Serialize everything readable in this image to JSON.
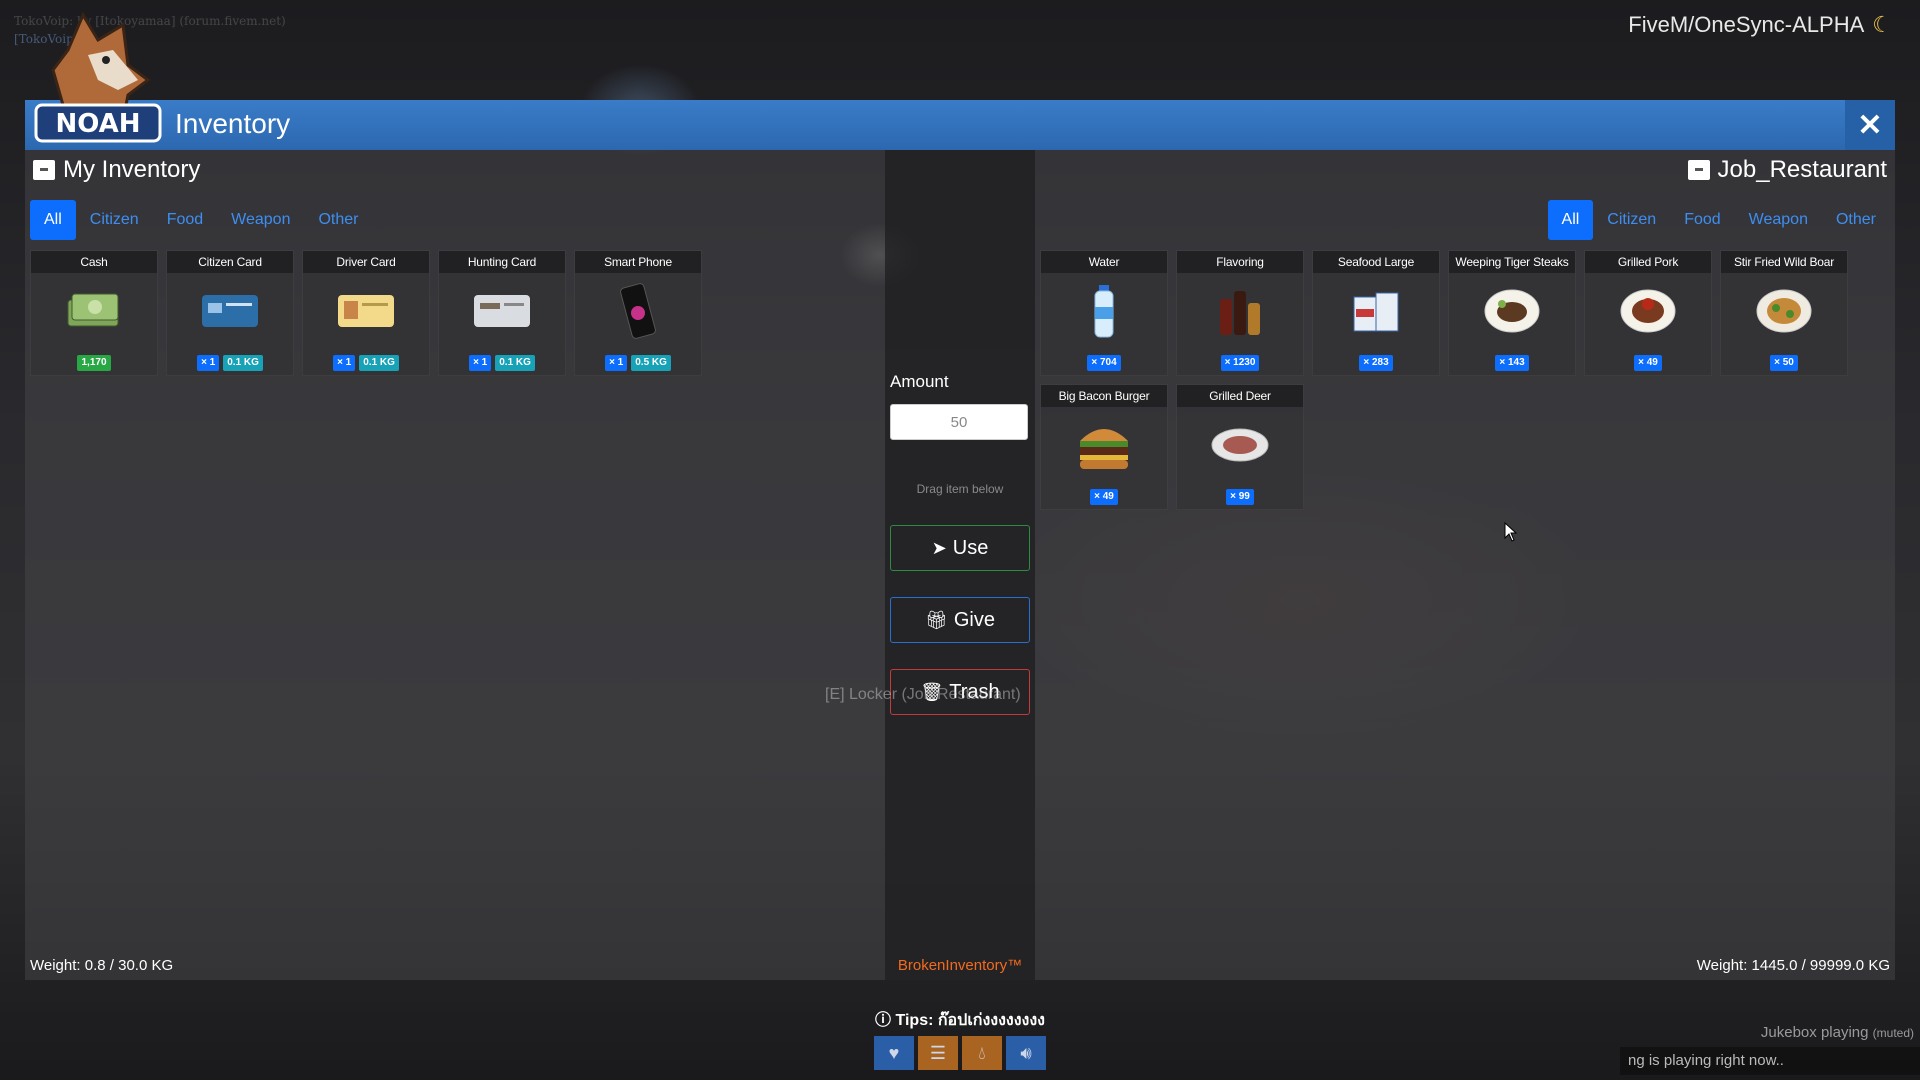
{
  "server_name": "FiveM/OneSync-ALPHA",
  "credit_line1": "TokoVoip: by [Itokoyamaa] (forum.fivem.net)",
  "credit_line2": "[TokoVoip]",
  "logo_text": "NOAH",
  "window": {
    "title": "Inventory",
    "close_label": "✕"
  },
  "left_panel": {
    "title": "My Inventory",
    "tabs": [
      "All",
      "Citizen",
      "Food",
      "Weapon",
      "Other"
    ],
    "items": [
      {
        "name": "Cash",
        "badges": [
          {
            "text": "1,170",
            "color": "green"
          }
        ],
        "icon": "cash-icon"
      },
      {
        "name": "Citizen Card",
        "badges": [
          {
            "text": "× 1",
            "color": "blue"
          },
          {
            "text": "0.1 KG",
            "color": "teal"
          }
        ],
        "icon": "citizen-card-icon"
      },
      {
        "name": "Driver Card",
        "badges": [
          {
            "text": "× 1",
            "color": "blue"
          },
          {
            "text": "0.1 KG",
            "color": "teal"
          }
        ],
        "icon": "driver-card-icon"
      },
      {
        "name": "Hunting Card",
        "badges": [
          {
            "text": "× 1",
            "color": "blue"
          },
          {
            "text": "0.1 KG",
            "color": "teal"
          }
        ],
        "icon": "hunting-card-icon"
      },
      {
        "name": "Smart Phone",
        "badges": [
          {
            "text": "× 1",
            "color": "blue"
          },
          {
            "text": "0.5 KG",
            "color": "teal"
          }
        ],
        "icon": "smart-phone-icon"
      }
    ],
    "weight": "Weight: 0.8 / 30.0 KG"
  },
  "center": {
    "amount_label": "Amount",
    "amount_value": "50",
    "drag_hint": "Drag item below",
    "use_label": "Use",
    "give_label": "Give",
    "trash_label": "Trash",
    "brand": "BrokenInventory™"
  },
  "right_panel": {
    "title": "Job_Restaurant",
    "tabs": [
      "All",
      "Citizen",
      "Food",
      "Weapon",
      "Other"
    ],
    "items": [
      {
        "name": "Water",
        "badges": [
          {
            "text": "× 704",
            "color": "blue"
          }
        ],
        "icon": "water-bottle-icon"
      },
      {
        "name": "Flavoring",
        "badges": [
          {
            "text": "× 1230",
            "color": "blue"
          }
        ],
        "icon": "flavoring-icon"
      },
      {
        "name": "Seafood Large",
        "badges": [
          {
            "text": "× 283",
            "color": "blue"
          }
        ],
        "icon": "seafood-icon"
      },
      {
        "name": "Weeping Tiger Steaks",
        "badges": [
          {
            "text": "× 143",
            "color": "blue"
          }
        ],
        "icon": "steak-icon"
      },
      {
        "name": "Grilled Pork",
        "badges": [
          {
            "text": "× 49",
            "color": "blue"
          }
        ],
        "icon": "grilled-pork-icon"
      },
      {
        "name": "Stir Fried Wild Boar",
        "badges": [
          {
            "text": "× 50",
            "color": "blue"
          }
        ],
        "icon": "stir-fry-icon"
      },
      {
        "name": "Big Bacon Burger",
        "badges": [
          {
            "text": "× 49",
            "color": "blue"
          }
        ],
        "icon": "burger-icon"
      },
      {
        "name": "Grilled Deer",
        "badges": [
          {
            "text": "× 99",
            "color": "blue"
          }
        ],
        "icon": "grilled-deer-icon"
      }
    ],
    "weight": "Weight: 1445.0 / 99999.0 KG"
  },
  "locker_hint": "[E] Locker (Job Restaurant)",
  "tips": "Tips: ก๊อปเก่งงงงงงงง",
  "jukebox": {
    "label": "Jukebox playing",
    "muted": "(muted)",
    "now_playing": "ng is playing right now.."
  },
  "colors": {
    "titlebar": "#2f6fb9",
    "tab_active": "#0d6efd",
    "brand": "#f26b1d",
    "badge_blue": "#0d6efd",
    "badge_teal": "#17a2b8",
    "badge_green": "#28a745"
  }
}
